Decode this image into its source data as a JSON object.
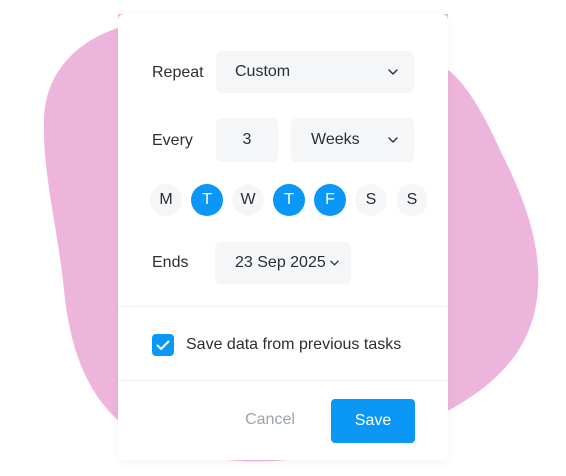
{
  "colors": {
    "accent": "#0a97f5",
    "blob": "#eeb5dc",
    "field_bg": "#f4f6f7"
  },
  "repeat": {
    "label": "Repeat",
    "value": "Custom",
    "icon": "chevron-down-icon"
  },
  "every": {
    "label": "Every",
    "count": "3",
    "unit": "Weeks",
    "icon": "chevron-down-icon"
  },
  "days": [
    {
      "label": "M",
      "selected": false
    },
    {
      "label": "T",
      "selected": true
    },
    {
      "label": "W",
      "selected": false
    },
    {
      "label": "T",
      "selected": true
    },
    {
      "label": "F",
      "selected": true
    },
    {
      "label": "S",
      "selected": false
    },
    {
      "label": "S",
      "selected": false
    }
  ],
  "ends": {
    "label": "Ends",
    "value": "23 Sep 2025",
    "icon": "chevron-down-icon"
  },
  "save_data": {
    "checked": true,
    "label": "Save data from previous tasks",
    "icon": "checkmark-icon"
  },
  "actions": {
    "cancel": "Cancel",
    "save": "Save"
  }
}
